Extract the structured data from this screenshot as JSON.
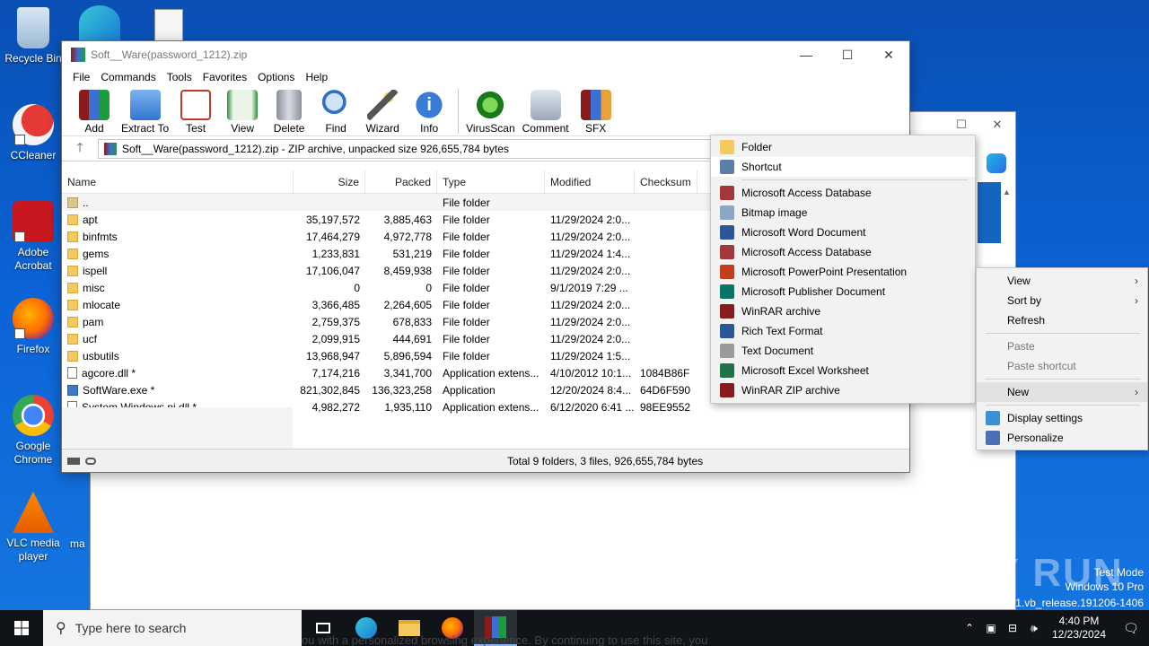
{
  "desktop_icons": [
    {
      "label": "Recycle Bin",
      "icon": "recycle-bin-icon"
    },
    {
      "label": "CCleaner",
      "icon": "ccleaner-icon"
    },
    {
      "label": "Adobe Acrobat",
      "icon": "acrobat-icon"
    },
    {
      "label": "Firefox",
      "icon": "firefox-icon"
    },
    {
      "label": "Google Chrome",
      "icon": "chrome-icon"
    },
    {
      "label": "VLC media player",
      "icon": "vlc-icon"
    }
  ],
  "desktop_partial_label": "ma",
  "winrar": {
    "title": "Soft__Ware(password_1212).zip",
    "menu": [
      "File",
      "Commands",
      "Tools",
      "Favorites",
      "Options",
      "Help"
    ],
    "toolbar": [
      "Add",
      "Extract To",
      "Test",
      "View",
      "Delete",
      "Find",
      "Wizard",
      "Info",
      "VirusScan",
      "Comment",
      "SFX"
    ],
    "address": "Soft__Ware(password_1212).zip - ZIP archive, unpacked size 926,655,784 bytes",
    "columns": [
      "Name",
      "Size",
      "Packed",
      "Type",
      "Modified",
      "Checksum"
    ],
    "rows": [
      {
        "name": "..",
        "size": "",
        "packed": "",
        "type": "File folder",
        "modified": "",
        "checksum": "",
        "kind": "up"
      },
      {
        "name": "apt",
        "size": "35,197,572",
        "packed": "3,885,463",
        "type": "File folder",
        "modified": "11/29/2024 2:0...",
        "checksum": "",
        "kind": "folder"
      },
      {
        "name": "binfmts",
        "size": "17,464,279",
        "packed": "4,972,778",
        "type": "File folder",
        "modified": "11/29/2024 2:0...",
        "checksum": "",
        "kind": "folder"
      },
      {
        "name": "gems",
        "size": "1,233,831",
        "packed": "531,219",
        "type": "File folder",
        "modified": "11/29/2024 1:4...",
        "checksum": "",
        "kind": "folder"
      },
      {
        "name": "ispell",
        "size": "17,106,047",
        "packed": "8,459,938",
        "type": "File folder",
        "modified": "11/29/2024 2:0...",
        "checksum": "",
        "kind": "folder"
      },
      {
        "name": "misc",
        "size": "0",
        "packed": "0",
        "type": "File folder",
        "modified": "9/1/2019 7:29 ...",
        "checksum": "",
        "kind": "folder"
      },
      {
        "name": "mlocate",
        "size": "3,366,485",
        "packed": "2,264,605",
        "type": "File folder",
        "modified": "11/29/2024 2:0...",
        "checksum": "",
        "kind": "folder"
      },
      {
        "name": "pam",
        "size": "2,759,375",
        "packed": "678,833",
        "type": "File folder",
        "modified": "11/29/2024 2:0...",
        "checksum": "",
        "kind": "folder"
      },
      {
        "name": "ucf",
        "size": "2,099,915",
        "packed": "444,691",
        "type": "File folder",
        "modified": "11/29/2024 2:0...",
        "checksum": "",
        "kind": "folder"
      },
      {
        "name": "usbutils",
        "size": "13,968,947",
        "packed": "5,896,594",
        "type": "File folder",
        "modified": "11/29/2024 1:5...",
        "checksum": "",
        "kind": "folder"
      },
      {
        "name": "agcore.dll *",
        "size": "7,174,216",
        "packed": "3,341,700",
        "type": "Application extens...",
        "modified": "4/10/2012 10:1...",
        "checksum": "1084B86F",
        "kind": "file"
      },
      {
        "name": "SoftWare.exe *",
        "size": "821,302,845",
        "packed": "136,323,258",
        "type": "Application",
        "modified": "12/20/2024 8:4...",
        "checksum": "64D6F590",
        "kind": "app"
      },
      {
        "name": "System.Windows.ni.dll *",
        "size": "4,982,272",
        "packed": "1,935,110",
        "type": "Application extens...",
        "modified": "6/12/2020 6:41 ...",
        "checksum": "98EE9552",
        "kind": "file"
      }
    ],
    "status": "Total 9 folders, 3 files, 926,655,784 bytes"
  },
  "new_submenu": {
    "items": [
      {
        "label": "Folder",
        "icon": "folder-icon",
        "color": "#f4c95d"
      },
      {
        "label": "Shortcut",
        "icon": "shortcut-icon",
        "color": "#5a7fa8"
      },
      {
        "sep": true
      },
      {
        "label": "Microsoft Access Database",
        "icon": "access-icon",
        "color": "#a4373a"
      },
      {
        "label": "Bitmap image",
        "icon": "bitmap-icon",
        "color": "#8aa7c4"
      },
      {
        "label": "Microsoft Word Document",
        "icon": "word-icon",
        "color": "#2b579a"
      },
      {
        "label": "Microsoft Access Database",
        "icon": "access-icon",
        "color": "#a4373a"
      },
      {
        "label": "Microsoft PowerPoint Presentation",
        "icon": "powerpoint-icon",
        "color": "#c43e1c"
      },
      {
        "label": "Microsoft Publisher Document",
        "icon": "publisher-icon",
        "color": "#077568"
      },
      {
        "label": "WinRAR archive",
        "icon": "winrar-icon",
        "color": "#8b1a1a"
      },
      {
        "label": "Rich Text Format",
        "icon": "rtf-icon",
        "color": "#2b579a"
      },
      {
        "label": "Text Document",
        "icon": "text-doc-icon",
        "color": "#9a9a9a"
      },
      {
        "label": "Microsoft Excel Worksheet",
        "icon": "excel-icon",
        "color": "#217346"
      },
      {
        "label": "WinRAR ZIP archive",
        "icon": "winrar-zip-icon",
        "color": "#8b1a1a"
      }
    ]
  },
  "desktop_menu": {
    "items": [
      {
        "label": "View",
        "arrow": true
      },
      {
        "label": "Sort by",
        "arrow": true
      },
      {
        "label": "Refresh"
      },
      {
        "sep": true
      },
      {
        "label": "Paste",
        "disabled": true
      },
      {
        "label": "Paste shortcut",
        "disabled": true
      },
      {
        "sep": true
      },
      {
        "label": "New",
        "arrow": true,
        "active": true
      },
      {
        "sep": true
      },
      {
        "label": "Display settings",
        "icon": "display-icon"
      },
      {
        "label": "Personalize",
        "icon": "personalize-icon"
      }
    ]
  },
  "taskbar": {
    "search_placeholder": "Type here to search",
    "time": "4:40 PM",
    "date": "12/23/2024"
  },
  "watermark": {
    "brand": "ANY RUN",
    "line1": "Test Mode",
    "line2": "Windows 10 Pro",
    "line3": "041.vb_release.191206-1406"
  },
  "background_text": "ou with a personalized browsing experience. By continuing to use this site, you"
}
